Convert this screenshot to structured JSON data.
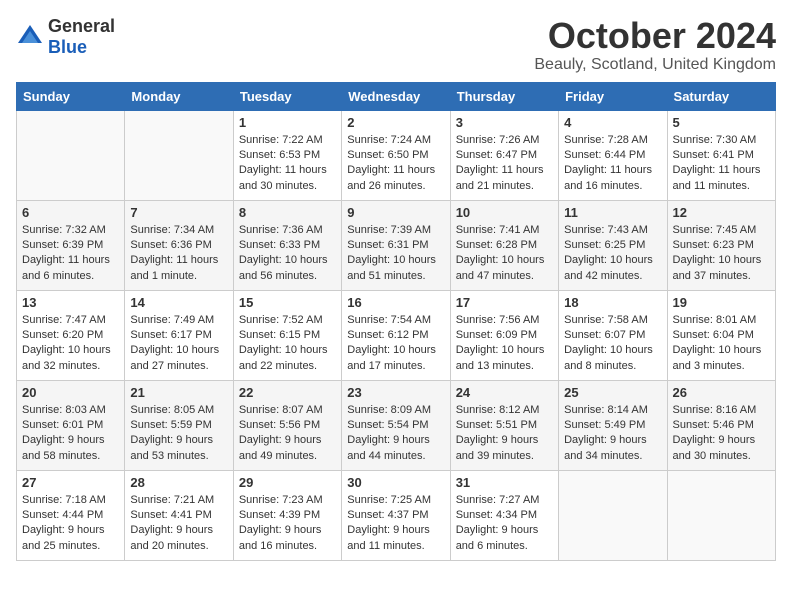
{
  "logo": {
    "general": "General",
    "blue": "Blue"
  },
  "title": "October 2024",
  "location": "Beauly, Scotland, United Kingdom",
  "days_header": [
    "Sunday",
    "Monday",
    "Tuesday",
    "Wednesday",
    "Thursday",
    "Friday",
    "Saturday"
  ],
  "weeks": [
    [
      {
        "day": "",
        "content": ""
      },
      {
        "day": "",
        "content": ""
      },
      {
        "day": "1",
        "content": "Sunrise: 7:22 AM\nSunset: 6:53 PM\nDaylight: 11 hours and 30 minutes."
      },
      {
        "day": "2",
        "content": "Sunrise: 7:24 AM\nSunset: 6:50 PM\nDaylight: 11 hours and 26 minutes."
      },
      {
        "day": "3",
        "content": "Sunrise: 7:26 AM\nSunset: 6:47 PM\nDaylight: 11 hours and 21 minutes."
      },
      {
        "day": "4",
        "content": "Sunrise: 7:28 AM\nSunset: 6:44 PM\nDaylight: 11 hours and 16 minutes."
      },
      {
        "day": "5",
        "content": "Sunrise: 7:30 AM\nSunset: 6:41 PM\nDaylight: 11 hours and 11 minutes."
      }
    ],
    [
      {
        "day": "6",
        "content": "Sunrise: 7:32 AM\nSunset: 6:39 PM\nDaylight: 11 hours and 6 minutes."
      },
      {
        "day": "7",
        "content": "Sunrise: 7:34 AM\nSunset: 6:36 PM\nDaylight: 11 hours and 1 minute."
      },
      {
        "day": "8",
        "content": "Sunrise: 7:36 AM\nSunset: 6:33 PM\nDaylight: 10 hours and 56 minutes."
      },
      {
        "day": "9",
        "content": "Sunrise: 7:39 AM\nSunset: 6:31 PM\nDaylight: 10 hours and 51 minutes."
      },
      {
        "day": "10",
        "content": "Sunrise: 7:41 AM\nSunset: 6:28 PM\nDaylight: 10 hours and 47 minutes."
      },
      {
        "day": "11",
        "content": "Sunrise: 7:43 AM\nSunset: 6:25 PM\nDaylight: 10 hours and 42 minutes."
      },
      {
        "day": "12",
        "content": "Sunrise: 7:45 AM\nSunset: 6:23 PM\nDaylight: 10 hours and 37 minutes."
      }
    ],
    [
      {
        "day": "13",
        "content": "Sunrise: 7:47 AM\nSunset: 6:20 PM\nDaylight: 10 hours and 32 minutes."
      },
      {
        "day": "14",
        "content": "Sunrise: 7:49 AM\nSunset: 6:17 PM\nDaylight: 10 hours and 27 minutes."
      },
      {
        "day": "15",
        "content": "Sunrise: 7:52 AM\nSunset: 6:15 PM\nDaylight: 10 hours and 22 minutes."
      },
      {
        "day": "16",
        "content": "Sunrise: 7:54 AM\nSunset: 6:12 PM\nDaylight: 10 hours and 17 minutes."
      },
      {
        "day": "17",
        "content": "Sunrise: 7:56 AM\nSunset: 6:09 PM\nDaylight: 10 hours and 13 minutes."
      },
      {
        "day": "18",
        "content": "Sunrise: 7:58 AM\nSunset: 6:07 PM\nDaylight: 10 hours and 8 minutes."
      },
      {
        "day": "19",
        "content": "Sunrise: 8:01 AM\nSunset: 6:04 PM\nDaylight: 10 hours and 3 minutes."
      }
    ],
    [
      {
        "day": "20",
        "content": "Sunrise: 8:03 AM\nSunset: 6:01 PM\nDaylight: 9 hours and 58 minutes."
      },
      {
        "day": "21",
        "content": "Sunrise: 8:05 AM\nSunset: 5:59 PM\nDaylight: 9 hours and 53 minutes."
      },
      {
        "day": "22",
        "content": "Sunrise: 8:07 AM\nSunset: 5:56 PM\nDaylight: 9 hours and 49 minutes."
      },
      {
        "day": "23",
        "content": "Sunrise: 8:09 AM\nSunset: 5:54 PM\nDaylight: 9 hours and 44 minutes."
      },
      {
        "day": "24",
        "content": "Sunrise: 8:12 AM\nSunset: 5:51 PM\nDaylight: 9 hours and 39 minutes."
      },
      {
        "day": "25",
        "content": "Sunrise: 8:14 AM\nSunset: 5:49 PM\nDaylight: 9 hours and 34 minutes."
      },
      {
        "day": "26",
        "content": "Sunrise: 8:16 AM\nSunset: 5:46 PM\nDaylight: 9 hours and 30 minutes."
      }
    ],
    [
      {
        "day": "27",
        "content": "Sunrise: 7:18 AM\nSunset: 4:44 PM\nDaylight: 9 hours and 25 minutes."
      },
      {
        "day": "28",
        "content": "Sunrise: 7:21 AM\nSunset: 4:41 PM\nDaylight: 9 hours and 20 minutes."
      },
      {
        "day": "29",
        "content": "Sunrise: 7:23 AM\nSunset: 4:39 PM\nDaylight: 9 hours and 16 minutes."
      },
      {
        "day": "30",
        "content": "Sunrise: 7:25 AM\nSunset: 4:37 PM\nDaylight: 9 hours and 11 minutes."
      },
      {
        "day": "31",
        "content": "Sunrise: 7:27 AM\nSunset: 4:34 PM\nDaylight: 9 hours and 6 minutes."
      },
      {
        "day": "",
        "content": ""
      },
      {
        "day": "",
        "content": ""
      }
    ]
  ]
}
